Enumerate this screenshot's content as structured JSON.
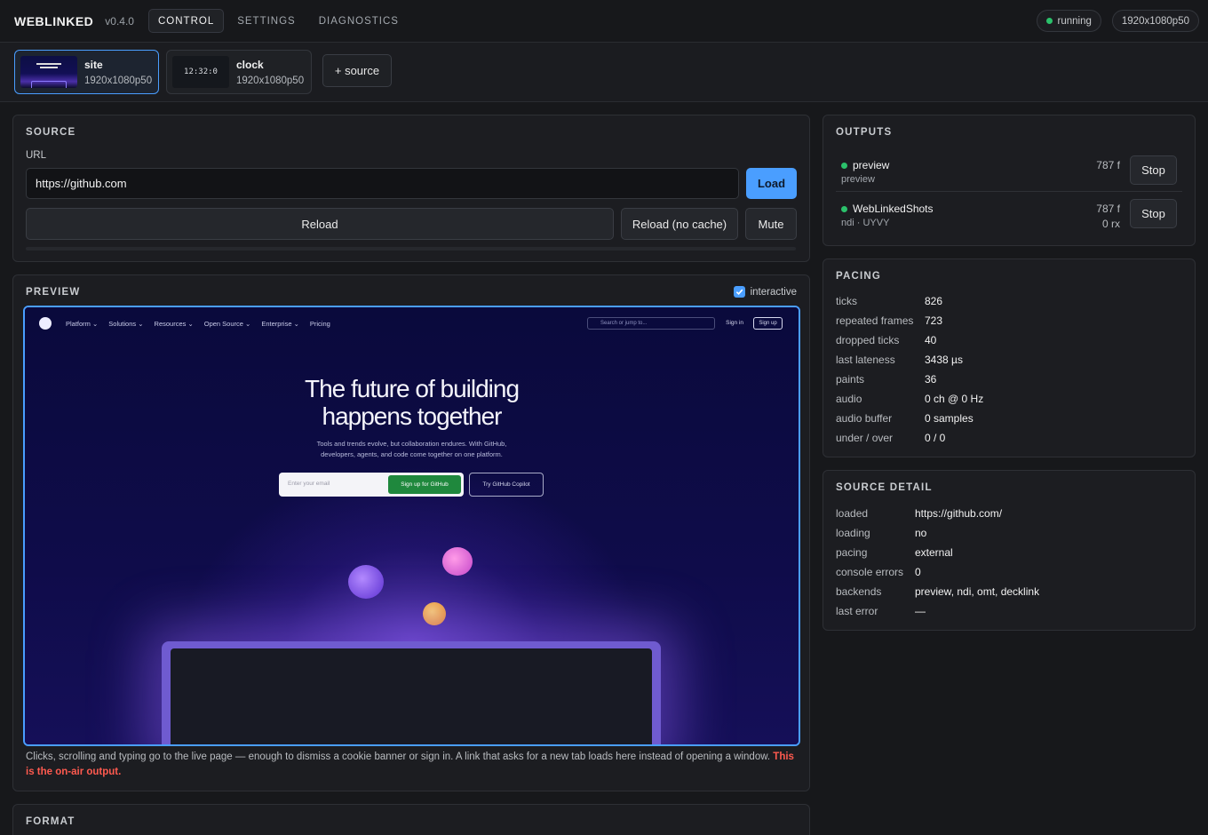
{
  "app": {
    "brand": "WEBLINKED",
    "version": "v0.4.0",
    "tabs": [
      "CONTROL",
      "SETTINGS",
      "DIAGNOSTICS"
    ],
    "status": "running",
    "status_color": "#2bc16b",
    "format": "1920x1080p50"
  },
  "sources": [
    {
      "name": "site",
      "format": "1920x1080p50"
    },
    {
      "name": "clock",
      "format": "1920x1080p50",
      "thumb_text": "12:32:0"
    }
  ],
  "add_source_label": "+ source",
  "source_panel": {
    "title": "SOURCE",
    "url_label": "URL",
    "url_value": "https://github.com",
    "load": "Load",
    "reload": "Reload",
    "reload_nocache": "Reload (no cache)",
    "mute": "Mute"
  },
  "preview": {
    "title": "PREVIEW",
    "interactive_label": "interactive",
    "interactive_checked": true,
    "page": {
      "nav": [
        "Platform ⌄",
        "Solutions ⌄",
        "Resources ⌄",
        "Open Source ⌄",
        "Enterprise ⌄",
        "Pricing"
      ],
      "search": "Search or jump to...",
      "signin": "Sign in",
      "signup": "Sign up",
      "headline_1": "The future of building",
      "headline_2": "happens together",
      "sub_1": "Tools and trends evolve, but collaboration endures. With GitHub,",
      "sub_2": "developers, agents, and code come together on one platform.",
      "email_placeholder": "Enter your email",
      "signup_github": "Sign up for GitHub",
      "copilot": "Try GitHub Copilot"
    },
    "note": "Clicks, scrolling and typing go to the live page — enough to dismiss a cookie banner or sign in. A link that asks for a new tab loads here instead of opening a window.",
    "note_warning": "This is the on-air output."
  },
  "format_panel": {
    "title": "FORMAT"
  },
  "outputs": {
    "title": "OUTPUTS",
    "items": [
      {
        "name": "preview",
        "sub": "preview",
        "frames": "787 f",
        "rx": "",
        "stop": "Stop"
      },
      {
        "name": "WebLinkedShots",
        "sub": "ndi · UYVY",
        "frames": "787 f",
        "rx": "0 rx",
        "stop": "Stop"
      }
    ]
  },
  "pacing": {
    "title": "PACING",
    "rows": [
      {
        "k": "ticks",
        "v": "826"
      },
      {
        "k": "repeated frames",
        "v": "723"
      },
      {
        "k": "dropped ticks",
        "v": "40"
      },
      {
        "k": "last lateness",
        "v": "3438 µs"
      },
      {
        "k": "paints",
        "v": "36"
      },
      {
        "k": "audio",
        "v": "0 ch @ 0 Hz"
      },
      {
        "k": "audio buffer",
        "v": "0 samples"
      },
      {
        "k": "under / over",
        "v": "0 / 0"
      }
    ]
  },
  "source_detail": {
    "title": "SOURCE DETAIL",
    "rows": [
      {
        "k": "loaded",
        "v": "https://github.com/"
      },
      {
        "k": "loading",
        "v": "no"
      },
      {
        "k": "pacing",
        "v": "external"
      },
      {
        "k": "console errors",
        "v": "0"
      },
      {
        "k": "backends",
        "v": "preview, ndi, omt, decklink"
      },
      {
        "k": "last error",
        "v": "—"
      }
    ]
  }
}
